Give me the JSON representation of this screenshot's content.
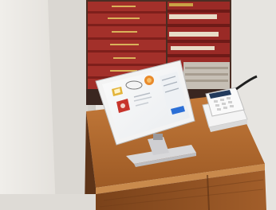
{
  "scene": {
    "description_tags": [
      "tablet-kiosk",
      "card-reader",
      "bookshelf",
      "wooden-table",
      "white-wall"
    ],
    "colors": {
      "wall": "#ebe8e4",
      "wall_shadow": "#d4d1cc",
      "table_top": "#b06a2e",
      "table_front": "#8c4f20",
      "book_red": "#a3302a",
      "book_red_dark": "#7e1f1b",
      "tablet_frame": "#f2f2f2",
      "stand": "#e1e1e3",
      "reader_body": "#f4f4f4",
      "reader_screen": "#223a5c"
    }
  }
}
